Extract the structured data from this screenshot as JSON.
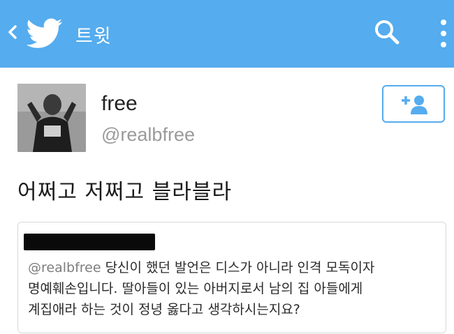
{
  "appbar": {
    "title": "트윗",
    "background": "#55acee",
    "back_icon": "chevron-left-icon",
    "logo_icon": "twitter-bird-icon",
    "search_icon": "search-icon",
    "more_icon": "more-vertical-icon"
  },
  "profile": {
    "display_name": "free",
    "handle": "@realbfree",
    "follow_icon": "add-user-icon"
  },
  "tweet": {
    "text": "어쩌고 저쩌고 블라블라"
  },
  "quoted_reply": {
    "mention": "@realbfree",
    "line1_rest": " 당신이 했던 발언은 디스가 아니라 인격 모독이자",
    "line2": "명예훼손입니다. 딸아들이 있는 아버지로서 남의 집 아들에게",
    "line3": "계집애라 하는 것이 정녕 옳다고 생각하시는지요?"
  }
}
